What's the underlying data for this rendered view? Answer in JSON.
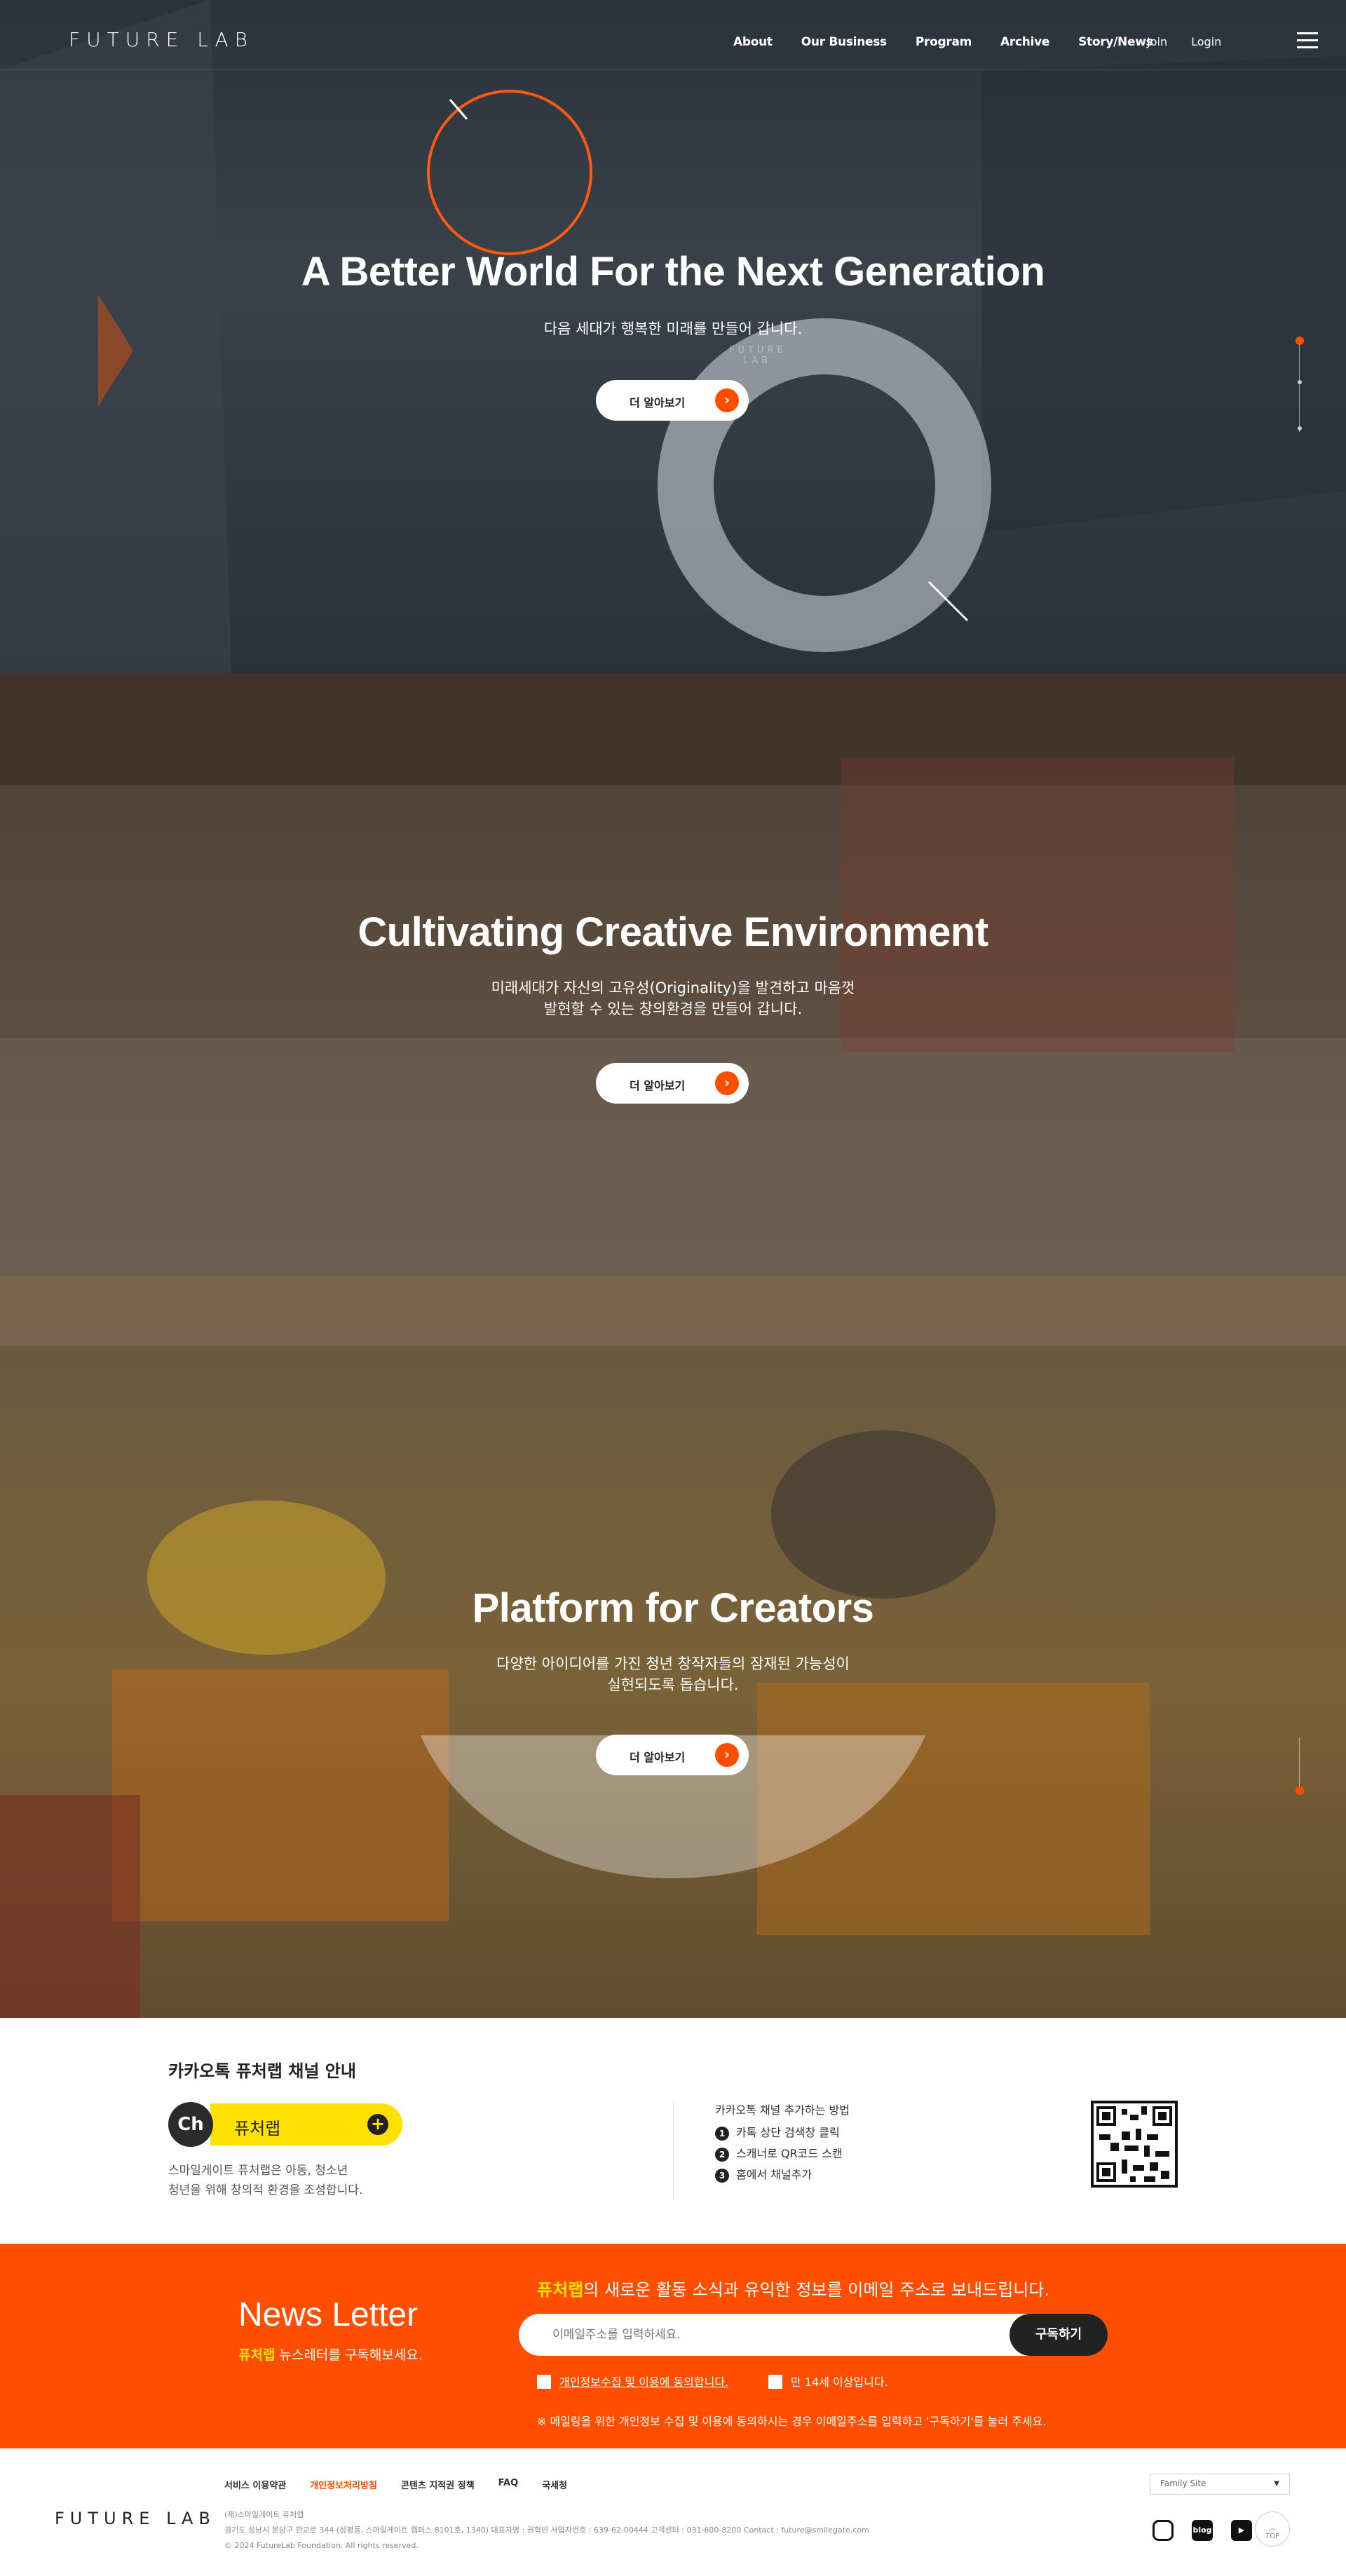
{
  "header": {
    "logo": "FUTURE LAB",
    "nav": [
      "About",
      "Our Business",
      "Program",
      "Archive",
      "Story/News"
    ],
    "util": [
      "Join",
      "Login"
    ]
  },
  "sections": [
    {
      "title": "A Better World For the Next Generation",
      "subtitle": "다음 세대가 행복한 미래를 만들어 갑니다.",
      "button": "더 알아보기",
      "watermark": "FUTURE LAB"
    },
    {
      "title": "Cultivating Creative Environment",
      "subtitle": "미래세대가 자신의 고유성(Originality)을 발견하고 마음껏\n발현할 수 있는 창의환경을 만들어 갑니다.",
      "button": "더 알아보기"
    },
    {
      "title": "Platform for Creators",
      "subtitle": "다양한 아이디어를 가진 청년 창작자들의 잠재된 가능성이\n실현되도록 돕습니다.",
      "button": "더 알아보기"
    }
  ],
  "kakao": {
    "title": "카카오톡 퓨처랩 채널 안내",
    "ch": "Ch",
    "channel_name": "퓨처랩",
    "desc": "스마일게이트 퓨처랩은 아동, 청소년\n청년을 위해 창의적 환경을 조성합니다.",
    "how_title": "카카오톡 채널 추가하는 방법",
    "steps": [
      "카톡 상단 검색창 클릭",
      "스캐너로 QR코드 스캔",
      "홈에서 채널추가"
    ],
    "step_nums": [
      "1",
      "2",
      "3"
    ]
  },
  "newsletter": {
    "title": "News Letter",
    "sub_highlight": "퓨처랩",
    "sub_rest": " 뉴스레터를 구독해보세요.",
    "head_highlight": "퓨처랩",
    "head_rest": "의 새로운 활동 소식과 유익한 정보를 이메일 주소로 보내드립니다.",
    "placeholder": "이메일주소를 입력하세요.",
    "button": "구독하기",
    "check1": "개인정보수집 및 이용에 동의합니다.",
    "check2": "만 14세 이상입니다.",
    "note": "※ 메일링을 위한 개인정보 수집 및 이용에 동의하시는 경우 이메일주소를 입력하고 '구독하기'를 눌러 주세요."
  },
  "footer": {
    "logo": "FUTURE LAB",
    "links": [
      "서비스 이용약관",
      "개인정보처리방침",
      "콘텐츠 지적권 정책",
      "FAQ",
      "국세청"
    ],
    "info1": "(재)스마일게이트 퓨처랩",
    "info2": "경기도 성남시 분당구 판교로 344 (삼평동, 스마일게이트 캠퍼스 8101호, 1340)   대표자명 : 권혁빈   사업자번호 : 639-62-00444   고객센터 : 031-600-8200   Contact : future@smilegate.com",
    "copyright": "© 2024 FutureLab Foundation. All rights reserved.",
    "family_site": "Family Site",
    "blog": "blog",
    "top": "TOP"
  },
  "colors": {
    "accent": "#ff4e00",
    "kakao_yellow": "#ffe100"
  }
}
